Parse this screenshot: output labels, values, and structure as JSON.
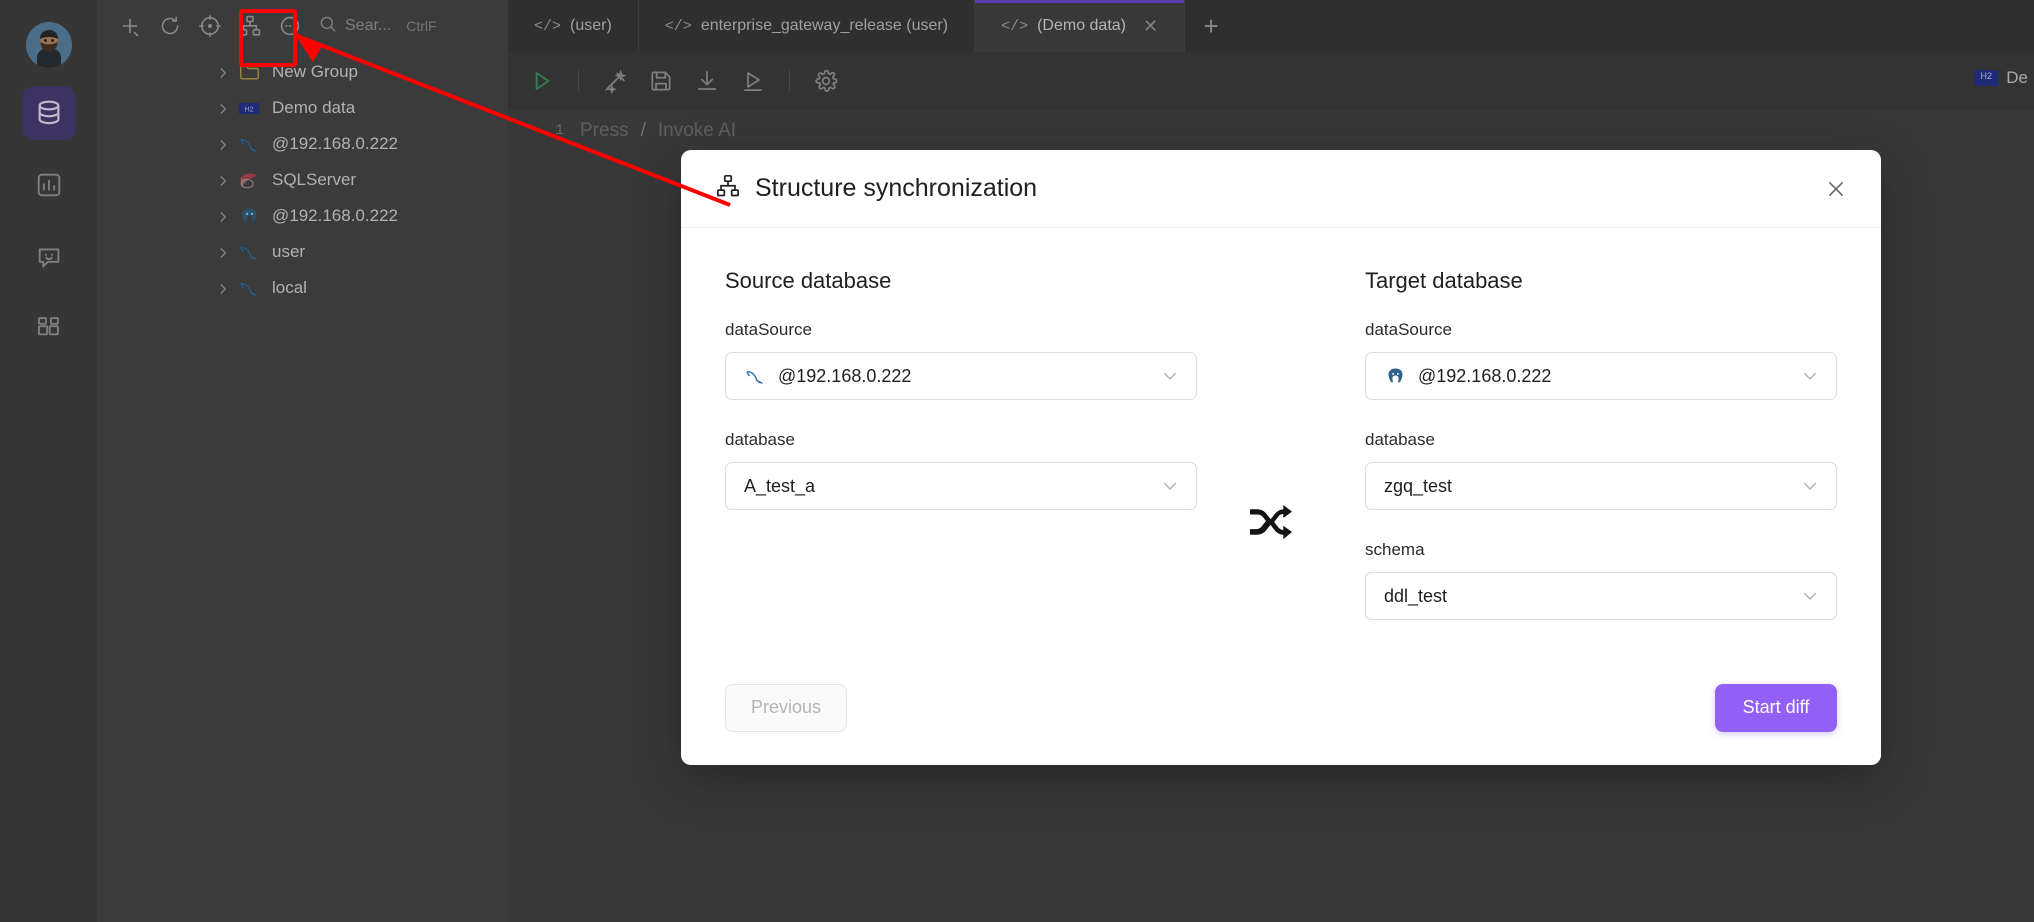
{
  "app": {
    "rail": {
      "avatar_name": "user-avatar",
      "items": [
        {
          "name": "database-icon",
          "label": "Database",
          "active": true
        },
        {
          "name": "chart-icon",
          "label": "Charts",
          "active": false
        },
        {
          "name": "chat-icon",
          "label": "Chat",
          "active": false
        },
        {
          "name": "apps-icon",
          "label": "Apps",
          "active": false
        }
      ]
    },
    "tree_toolbar": {
      "icons": [
        {
          "name": "add-icon",
          "label": "New"
        },
        {
          "name": "refresh-icon",
          "label": "Refresh"
        },
        {
          "name": "locate-icon",
          "label": "Locate"
        },
        {
          "name": "structure-sync-icon",
          "label": "Structure synchronization"
        },
        {
          "name": "more-icon",
          "label": "More"
        }
      ],
      "search_placeholder": "Sear...",
      "search_shortcut": "CtrlF"
    },
    "tree": {
      "items": [
        {
          "label": "New Group",
          "icon": "folder-icon"
        },
        {
          "label": "Demo data",
          "icon": "h2-icon"
        },
        {
          "label": "@192.168.0.222",
          "icon": "mysql-icon"
        },
        {
          "label": "SQLServer",
          "icon": "sqlserver-icon"
        },
        {
          "label": "@192.168.0.222",
          "icon": "postgresql-icon"
        },
        {
          "label": "user",
          "icon": "mysql-icon"
        },
        {
          "label": "local",
          "icon": "mysql-icon"
        }
      ]
    },
    "tabs": [
      {
        "label": "(user)",
        "prefix": "</>",
        "active": false,
        "closable": false
      },
      {
        "label": "enterprise_gateway_release (user)",
        "prefix": "</>",
        "active": false,
        "closable": false
      },
      {
        "label": "(Demo data)",
        "prefix": "</>",
        "active": true,
        "closable": true,
        "close_glyph": "✕"
      }
    ],
    "tab_add_glyph": "+",
    "editor_toolbar": {
      "icons": [
        {
          "name": "run-icon",
          "label": "Run"
        },
        {
          "name": "magic-wand-icon",
          "label": "Format"
        },
        {
          "name": "save-icon",
          "label": "Save"
        },
        {
          "name": "download-icon",
          "label": "Export"
        },
        {
          "name": "run-to-cursor-icon",
          "label": "Run to cursor"
        },
        {
          "name": "settings-gear-icon",
          "label": "Settings"
        }
      ]
    },
    "editor": {
      "line_number": "1",
      "placeholder_press": "Press",
      "placeholder_slash": "/",
      "placeholder_action": "Invoke AI"
    },
    "right_status": {
      "badge": "H2",
      "label": "De"
    }
  },
  "dialog": {
    "title": "Structure synchronization",
    "title_icon": "structure-sync-icon",
    "close_glyph": "✕",
    "swap_icon": "shuffle-arrows-icon",
    "source": {
      "heading": "Source database",
      "datasource_label": "dataSource",
      "datasource_value": "@192.168.0.222",
      "datasource_icon": "mysql-icon",
      "database_label": "database",
      "database_value": "A_test_a"
    },
    "target": {
      "heading": "Target database",
      "datasource_label": "dataSource",
      "datasource_value": "@192.168.0.222",
      "datasource_icon": "postgresql-icon",
      "database_label": "database",
      "database_value": "zgq_test",
      "schema_label": "schema",
      "schema_value": "ddl_test"
    },
    "footer": {
      "previous_label": "Previous",
      "start_diff_label": "Start diff"
    }
  },
  "colors": {
    "accent_purple": "#9260f5",
    "rail_active": "#4b3f78",
    "annotation_red": "#ff0000",
    "tab_active_underline": "#6c4fd8",
    "mysql_blue": "#2f6fa8",
    "postgres_blue": "#31648c",
    "h2_navy": "#283593",
    "run_green": "#3f9b62"
  }
}
